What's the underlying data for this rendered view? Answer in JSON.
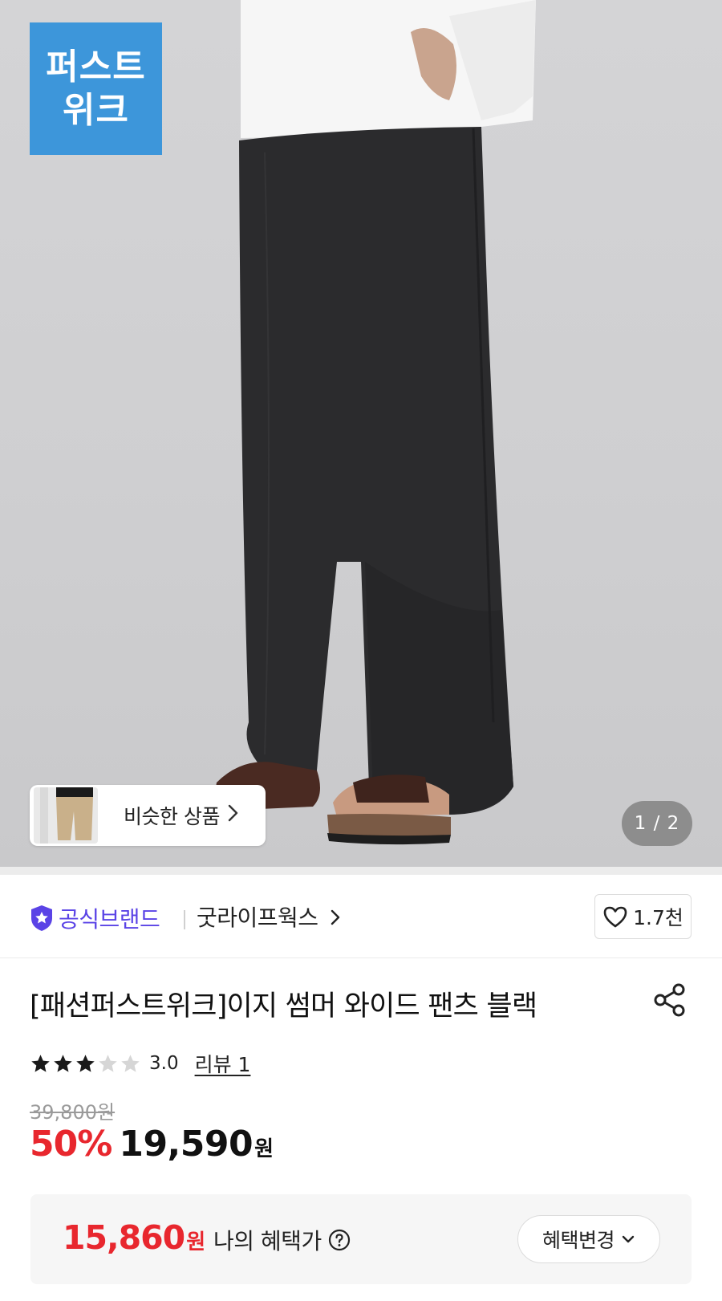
{
  "hero": {
    "brand_badge_line1": "퍼스트",
    "brand_badge_line2": "위크",
    "similar_label": "비슷한 상품",
    "pager": "1 / 2"
  },
  "brand": {
    "official_label": "공식브랜드",
    "store_name": "굿라이프웍스",
    "like_count": "1.7천"
  },
  "product": {
    "title": "[패션퍼스트위크]이지 썸머 와이드 팬츠 블랙",
    "rating": 3.0,
    "rating_text": "3.0",
    "review_label": "리뷰 1",
    "original_price": "39,800원",
    "discount": "50%",
    "price": "19,590",
    "currency": "원"
  },
  "benefit": {
    "price": "15,860",
    "currency": "원",
    "label": "나의 혜택가",
    "change_label": "혜택변경"
  },
  "colors": {
    "accent_red": "#e8272e",
    "official_purple": "#5a43e6",
    "badge_blue": "#3d96da"
  }
}
